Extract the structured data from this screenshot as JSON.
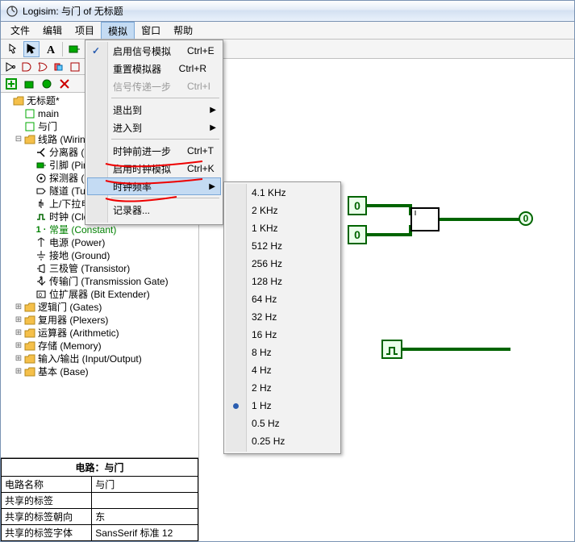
{
  "title": "Logisim: 与门 of 无标题",
  "menubar": [
    "文件",
    "编辑",
    "项目",
    "模拟",
    "窗口",
    "帮助"
  ],
  "sim_menu": {
    "enable_sim": {
      "label": "启用信号模拟",
      "shortcut": "Ctrl+E",
      "checked": true
    },
    "reset_sim": {
      "label": "重置模拟器",
      "shortcut": "Ctrl+R"
    },
    "step_signal": {
      "label": "信号传递一步",
      "shortcut": "Ctrl+I",
      "disabled": true
    },
    "exit_to": {
      "label": "退出到",
      "submenu": true
    },
    "enter_to": {
      "label": "进入到",
      "submenu": true
    },
    "tick_step": {
      "label": "时钟前进一步",
      "shortcut": "Ctrl+T"
    },
    "enable_tick": {
      "label": "启用时钟模拟",
      "shortcut": "Ctrl+K"
    },
    "tick_freq": {
      "label": "时钟频率",
      "submenu": true,
      "hover": true
    },
    "logger": {
      "label": "记录器..."
    }
  },
  "freq_menu": {
    "items": [
      {
        "label": "4.1 KHz"
      },
      {
        "label": "2 KHz"
      },
      {
        "label": "1 KHz"
      },
      {
        "label": "512 Hz"
      },
      {
        "label": "256 Hz"
      },
      {
        "label": "128 Hz"
      },
      {
        "label": "64 Hz"
      },
      {
        "label": "32 Hz"
      },
      {
        "label": "16 Hz"
      },
      {
        "label": "8 Hz"
      },
      {
        "label": "4 Hz"
      },
      {
        "label": "2 Hz"
      },
      {
        "label": "1 Hz",
        "selected": true
      },
      {
        "label": "0.5 Hz"
      },
      {
        "label": "0.25 Hz"
      }
    ]
  },
  "tree": {
    "root": "无标题*",
    "main": "main",
    "andgate": "与门",
    "wiring": "线路 (Wiring)",
    "wiring_items": [
      {
        "label": "分离器 (Splitter)",
        "icon": "splitter"
      },
      {
        "label": "引脚 (Pin)",
        "icon": "pin"
      },
      {
        "label": "探测器 (Probe)",
        "icon": "probe"
      },
      {
        "label": "隧道 (Tunnel)",
        "icon": "tunnel"
      },
      {
        "label": "上/下拉电阻 (Pull Resistor)",
        "icon": "pull"
      },
      {
        "label": "时钟 (Clock)",
        "icon": "clock"
      },
      {
        "label": "常量 (Constant)",
        "icon": "const",
        "green": true,
        "text": "1"
      },
      {
        "label": "电源 (Power)",
        "icon": "power"
      },
      {
        "label": "接地 (Ground)",
        "icon": "ground"
      },
      {
        "label": "三极管 (Transistor)",
        "icon": "trans"
      },
      {
        "label": "传输门 (Transmission Gate)",
        "icon": "tgate"
      },
      {
        "label": "位扩展器 (Bit Extender)",
        "icon": "bitext"
      }
    ],
    "folders": [
      "逻辑门 (Gates)",
      "复用器 (Plexers)",
      "运算器 (Arithmetic)",
      "存储 (Memory)",
      "输入/输出 (Input/Output)",
      "基本 (Base)"
    ]
  },
  "props": {
    "title": "电路：与门",
    "rows": [
      {
        "k": "电路名称",
        "v": "与门"
      },
      {
        "k": "共享的标签",
        "v": ""
      },
      {
        "k": "共享的标签朝向",
        "v": "东"
      },
      {
        "k": "共享的标签字体",
        "v": "SansSerif 标准 12"
      }
    ]
  },
  "canvas": {
    "pin1": "0",
    "pin2": "0",
    "out": "0"
  }
}
